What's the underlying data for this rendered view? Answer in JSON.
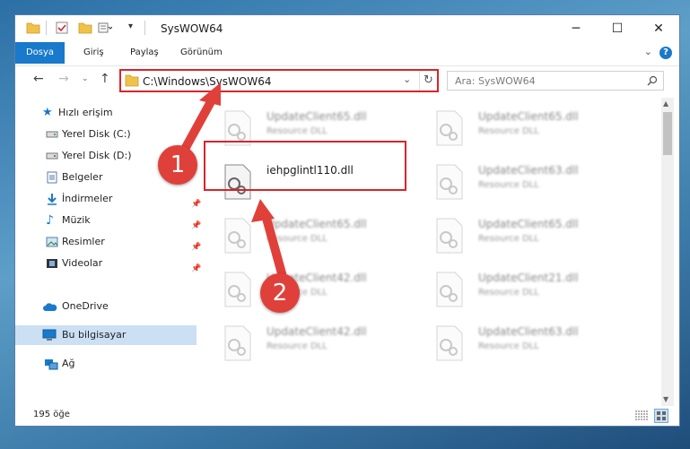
{
  "window": {
    "title": "SysWOW64"
  },
  "ribbon": {
    "tabs": [
      "Dosya",
      "Giriş",
      "Paylaş",
      "Görünüm"
    ]
  },
  "address": {
    "path": "C:\\Windows\\SysWOW64"
  },
  "search": {
    "placeholder": "Ara: SysWOW64"
  },
  "nav": {
    "items": [
      {
        "label": "Hızlı erişim",
        "icon": "star-icon"
      },
      {
        "label": "Yerel Disk (C:)",
        "icon": "drive-icon"
      },
      {
        "label": "Yerel Disk (D:)",
        "icon": "drive-icon"
      },
      {
        "label": "Belgeler",
        "icon": "documents-icon"
      },
      {
        "label": "İndirmeler",
        "icon": "download-icon"
      },
      {
        "label": "Müzik",
        "icon": "music-icon"
      },
      {
        "label": "Resimler",
        "icon": "pictures-icon"
      },
      {
        "label": "Videolar",
        "icon": "videos-icon"
      },
      {
        "label": "OneDrive",
        "icon": "cloud-icon"
      },
      {
        "label": "Bu bilgisayar",
        "icon": "computer-icon"
      },
      {
        "label": "Ağ",
        "icon": "network-icon"
      }
    ]
  },
  "files": [
    {
      "name": "UpdateClient65.dll",
      "type": "Resource DLL"
    },
    {
      "name": "UpdateClient65.dll",
      "type": "Resource DLL"
    },
    {
      "name": "iehpglintl110.dll",
      "type": ""
    },
    {
      "name": "UpdateClient63.dll",
      "type": "Resource DLL"
    },
    {
      "name": "UpdateClient65.dll",
      "type": "Resource DLL"
    },
    {
      "name": "UpdateClient65.dll",
      "type": "Resource DLL"
    },
    {
      "name": "UpdateClient42.dll",
      "type": "Resource DLL"
    },
    {
      "name": "UpdateClient21.dll",
      "type": "Resource DLL"
    },
    {
      "name": "UpdateClient42.dll",
      "type": "Resource DLL"
    },
    {
      "name": "UpdateClient63.dll",
      "type": "Resource DLL"
    }
  ],
  "status": {
    "count": "195 öğe"
  },
  "annotations": {
    "step1": "1",
    "step2": "2"
  },
  "colors": {
    "accent": "#1979ca",
    "highlight": "#d8242b",
    "selected": "#cce0f4"
  }
}
